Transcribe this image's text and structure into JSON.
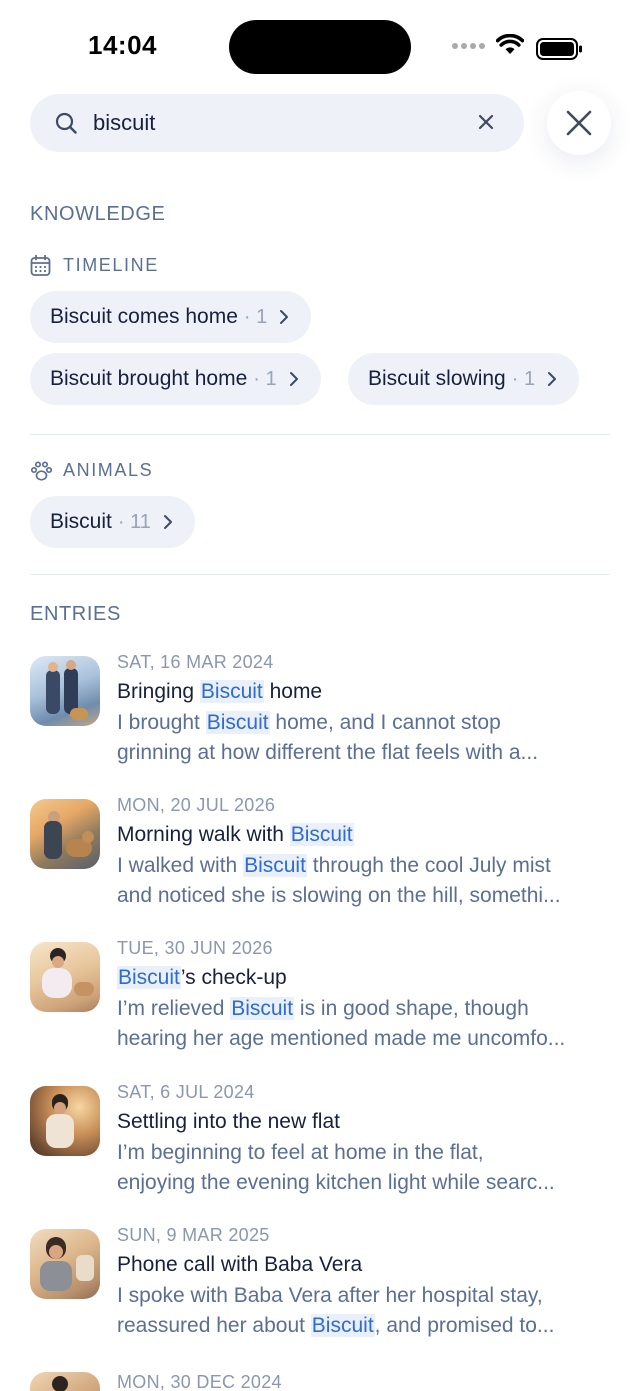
{
  "status_bar": {
    "time": "14:04"
  },
  "search": {
    "value": "biscuit"
  },
  "knowledge": {
    "heading": "KNOWLEDGE",
    "timeline": {
      "label": "TIMELINE",
      "chips": [
        {
          "label": "Biscuit comes home",
          "count": "· 1"
        },
        {
          "label": "Biscuit brought home",
          "count": "· 1"
        },
        {
          "label": "Biscuit slowing",
          "count": "· 1"
        }
      ]
    },
    "animals": {
      "label": "ANIMALS",
      "chips": [
        {
          "label": "Biscuit",
          "count": "· 11"
        }
      ]
    }
  },
  "entries": {
    "heading": "ENTRIES",
    "items": [
      {
        "date": "SAT, 16 MAR 2024",
        "title": [
          "Bringing ",
          "Biscuit",
          " home"
        ],
        "line1": [
          "I brought ",
          "Biscuit",
          " home, and I cannot stop"
        ],
        "line2": "grinning at how different the flat feels with a..."
      },
      {
        "date": "MON, 20 JUL 2026",
        "title": [
          "Morning walk with ",
          "Biscuit",
          ""
        ],
        "line1": [
          "I walked with ",
          "Biscuit",
          " through the cool July mist"
        ],
        "line2": "and noticed she is slowing on the hill, somethi..."
      },
      {
        "date": "TUE, 30 JUN 2026",
        "title": [
          "",
          "Biscuit",
          "’s check-up"
        ],
        "line1": [
          "I’m relieved ",
          "Biscuit",
          " is in good shape, though"
        ],
        "line2": "hearing her age mentioned made me uncomfo..."
      },
      {
        "date": "SAT, 6 JUL 2024",
        "title": "Settling into the new flat",
        "line1": "I’m beginning to feel at home in the flat,",
        "line2": "enjoying the evening kitchen light while searc..."
      },
      {
        "date": "SUN, 9 MAR 2025",
        "title": "Phone call with Baba Vera",
        "line1": "I spoke with Baba Vera after her hospital stay,",
        "line2": [
          "reassured her about ",
          "Biscuit",
          ", and promised to..."
        ]
      },
      {
        "date": "MON, 30 DEC 2024"
      }
    ]
  },
  "colors": {
    "accent": "#2f6bd1",
    "highlight_bg": "#e9f0fb",
    "chip_bg": "#eef2f8",
    "text_primary": "#17213d",
    "text_secondary": "#5b6f93"
  },
  "icons": {
    "search": "search-icon",
    "clear": "clear-icon",
    "close": "close-icon",
    "timeline": "calendar-icon",
    "animals": "paw-icon",
    "chevron": "chevron-right-icon"
  }
}
